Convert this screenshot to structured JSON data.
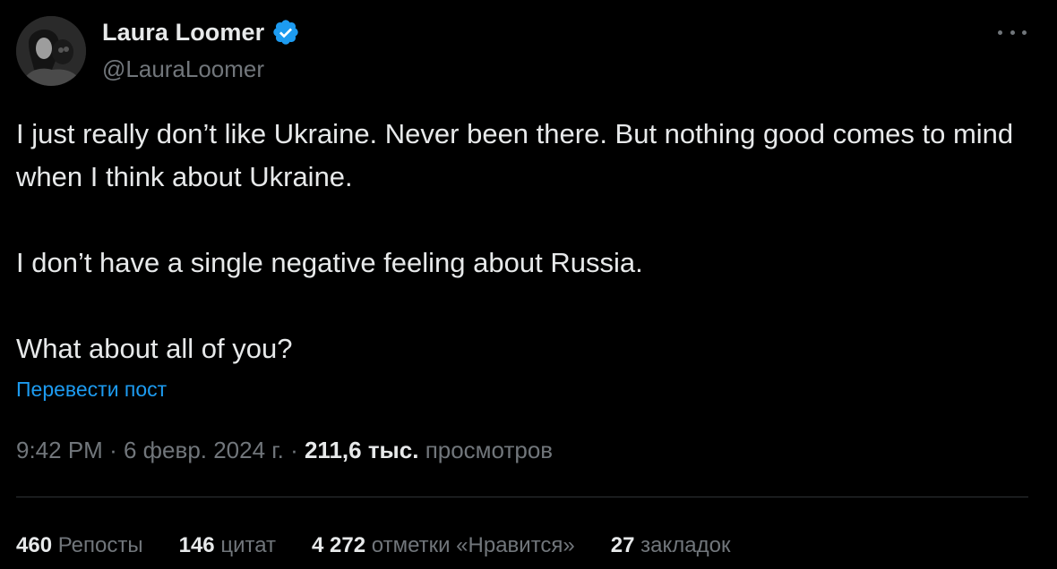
{
  "author": {
    "name": "Laura Loomer",
    "handle": "@LauraLoomer",
    "verified": true,
    "verified_color": "#1d9bf0"
  },
  "tweet": {
    "paragraphs": [
      "I just really don’t like Ukraine. Never been there. But nothing good comes to mind when I think about Ukraine.",
      "I don’t have a single negative feeling about Russia.",
      "What about all of you?"
    ],
    "translate_label": "Перевести пост"
  },
  "meta": {
    "time": "9:42 PM",
    "separator": "·",
    "date": "6 февр. 2024 г.",
    "views_count": "211,6 тыс.",
    "views_label": "просмотров"
  },
  "stats": [
    {
      "count": "460",
      "label": "Репосты"
    },
    {
      "count": "146",
      "label": "цитат"
    },
    {
      "count": "4 272",
      "label": "отметки «Нравится»"
    },
    {
      "count": "27",
      "label": "закладок"
    }
  ],
  "icons": {
    "more": "more-horizontal-icon",
    "verified": "verified-badge-icon"
  },
  "colors": {
    "background": "#000000",
    "text_primary": "#e7e9ea",
    "text_secondary": "#71767b",
    "accent": "#1d9bf0",
    "divider": "#2f3336"
  }
}
